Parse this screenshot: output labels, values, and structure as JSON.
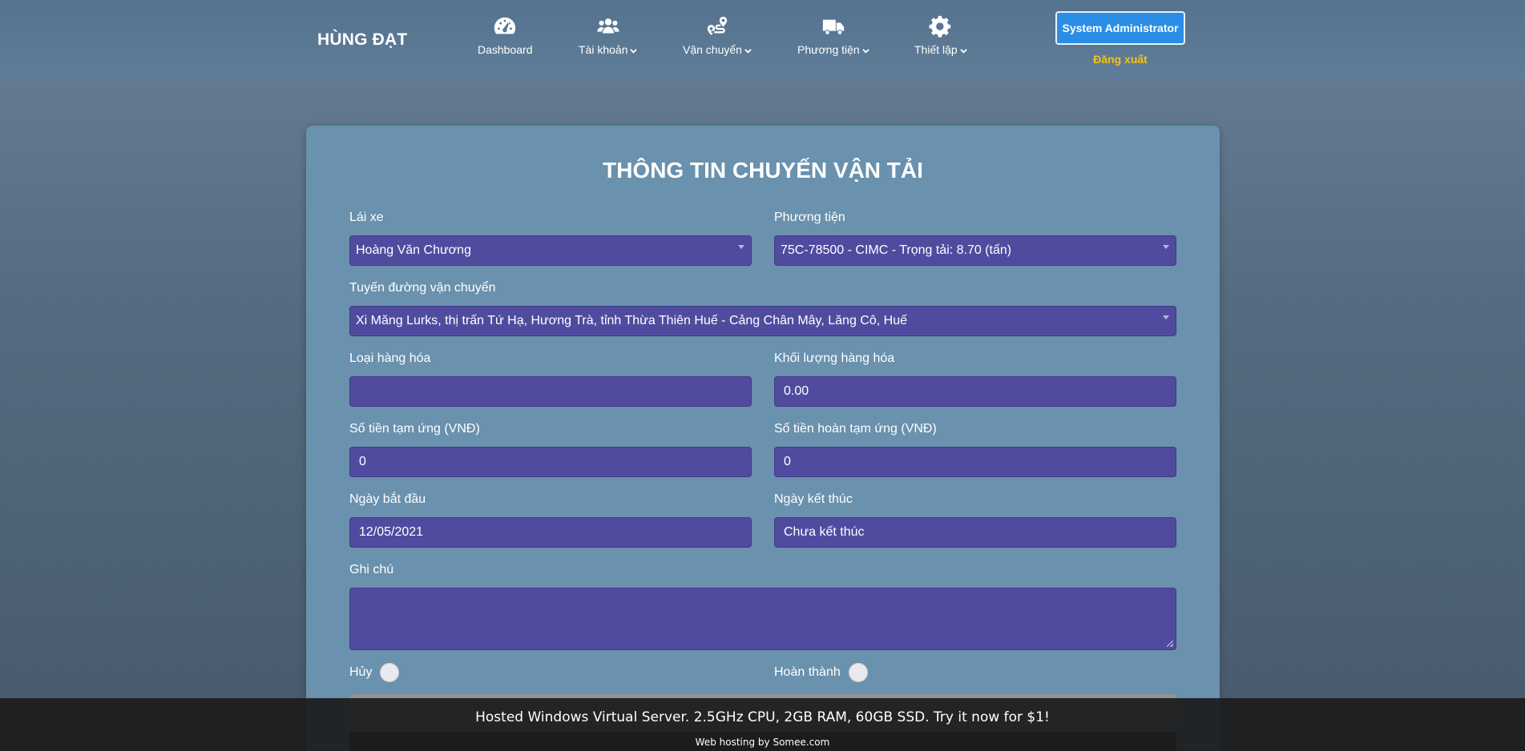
{
  "header": {
    "brand": "HÙNG ĐẠT",
    "nav": [
      {
        "label": "Dashboard",
        "icon": "speedometer-icon",
        "dropdown": false
      },
      {
        "label": "Tài khoản",
        "icon": "users-icon",
        "dropdown": true
      },
      {
        "label": "Vận chuyển",
        "icon": "route-icon",
        "dropdown": true
      },
      {
        "label": "Phương tiện",
        "icon": "truck-icon",
        "dropdown": true
      },
      {
        "label": "Thiết lập",
        "icon": "gear-icon",
        "dropdown": true
      }
    ],
    "user_button": "System Administrator",
    "logout": "Đăng xuất"
  },
  "form": {
    "title": "THÔNG TIN CHUYẾN VẬN TẢI",
    "driver": {
      "label": "Lái xe",
      "value": "Hoàng Văn Chương"
    },
    "vehicle": {
      "label": "Phương tiện",
      "value": "75C-78500 - CIMC - Trọng tải: 8.70 (tấn)"
    },
    "route": {
      "label": "Tuyến đường vận chuyển",
      "value": "Xi Măng Lurks, thị trấn Tứ Hạ, Hương Trà, tỉnh Thừa Thiên Huế - Cảng Chân Mây, Lăng Cô, Huế"
    },
    "cargo_type": {
      "label": "Loại hàng hóa",
      "value": ""
    },
    "cargo_weight": {
      "label": "Khối lượng hàng hóa",
      "value": "0.00"
    },
    "advance": {
      "label": "Số tiền tạm ứng (VNĐ)",
      "value": "0"
    },
    "refund": {
      "label": "Số tiền hoàn tạm ứng (VNĐ)",
      "value": "0"
    },
    "start_date": {
      "label": "Ngày bắt đầu",
      "value": "12/05/2021"
    },
    "end_date": {
      "label": "Ngày kết thúc",
      "value": "Chưa kết thúc"
    },
    "note": {
      "label": "Ghi chú",
      "value": ""
    },
    "cancel_toggle": {
      "label": "Hủy",
      "checked": false
    },
    "complete_toggle": {
      "label": "Hoàn thành",
      "checked": false
    }
  },
  "ad": {
    "main": "Hosted Windows Virtual Server. 2.5GHz CPU, 2GB RAM, 60GB SSD. Try it now for $1!",
    "sub": "Web hosting by Somee.com"
  },
  "colors": {
    "field_bg": "#514ba0",
    "card_bg": "#6a91ae",
    "user_button_bg": "#2a8ee6",
    "logout_text": "#f6c21b"
  }
}
